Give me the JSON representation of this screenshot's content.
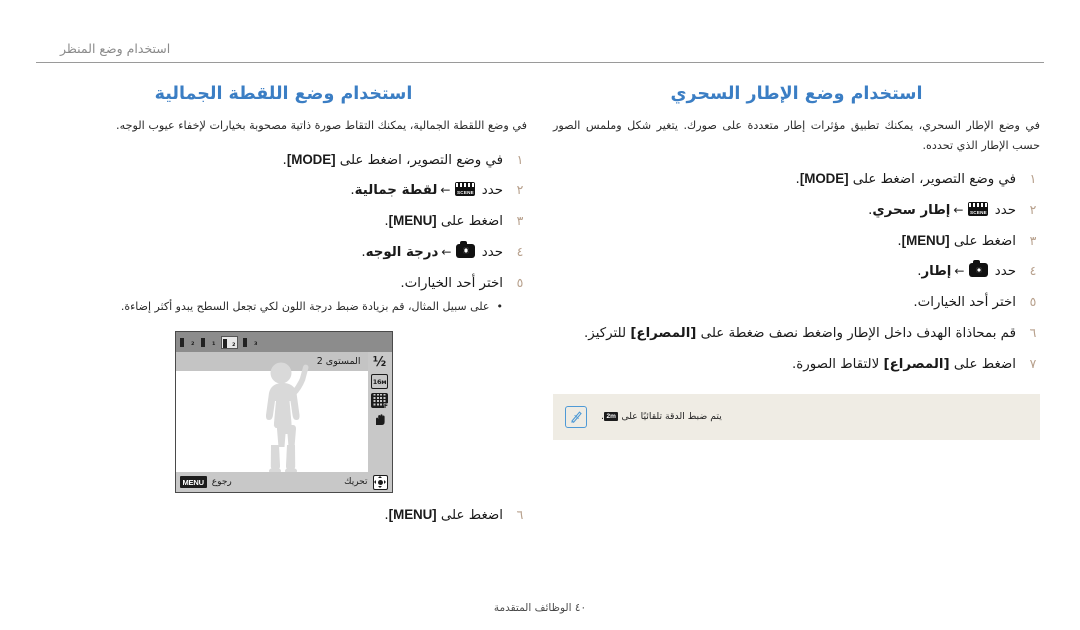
{
  "header": {
    "running_title": "استخدام وضع المنظر"
  },
  "footer": {
    "label": "الوظائف المتقدمة",
    "page_number": "٤٠"
  },
  "right_column": {
    "title": "استخدام وضع الإطار السحري",
    "intro": "في وضع الإطار السحري، يمكنك تطبيق مؤثرات إطار متعددة على صورك. يتغير شكل وملمس الصور حسب الإطار الذي تحدده.",
    "steps": [
      {
        "num": "١",
        "pre": "في وضع التصوير، اضغط على ",
        "kbd": "[MODE]",
        "post": "."
      },
      {
        "num": "٢",
        "pre": "حدد ",
        "icon": "scene-icon",
        "arrow": "←",
        "bold": "إطار سحري",
        "post": "."
      },
      {
        "num": "٣",
        "pre": "اضغط على ",
        "kbd": "[MENU]",
        "post": "."
      },
      {
        "num": "٤",
        "pre": "حدد ",
        "icon": "camera-icon",
        "arrow": "←",
        "bold": "إطار",
        "post": "."
      },
      {
        "num": "٥",
        "pre": "اختر أحد الخيارات.",
        "post": ""
      },
      {
        "num": "٦",
        "pre": "قم بمحاذاة الهدف داخل الإطار واضغط نصف ضغطة على ",
        "bold": "[المصراع]",
        "post": " للتركيز."
      },
      {
        "num": "٧",
        "pre": "اضغط على ",
        "bold": "[المصراع]",
        "post": " لالتقاط الصورة."
      }
    ],
    "note": {
      "icon": "note-pen-icon",
      "text_before": "يتم ضبط الدقة تلقائيًا على ",
      "chip": "2m",
      "text_after": "."
    }
  },
  "left_column": {
    "title": "استخدام وضع اللقطة الجمالية",
    "intro": "في وضع اللقطة الجمالية، يمكنك التقاط صورة ذاتية مصحوبة بخيارات لإخفاء عيوب الوجه.",
    "steps": [
      {
        "num": "١",
        "pre": "في وضع التصوير، اضغط على ",
        "kbd": "[MODE]",
        "post": "."
      },
      {
        "num": "٢",
        "pre": "حدد ",
        "icon": "scene-icon",
        "arrow": "←",
        "bold": "لقطة جمالية",
        "post": "."
      },
      {
        "num": "٣",
        "pre": "اضغط على ",
        "kbd": "[MENU]",
        "post": "."
      },
      {
        "num": "٤",
        "pre": "حدد ",
        "icon": "camera-icon",
        "arrow": "←",
        "bold": "درجة الوجه",
        "post": "."
      },
      {
        "num": "٥",
        "pre": "اختر أحد الخيارات.",
        "post": ""
      }
    ],
    "bullet": "على سبيل المثال، قم بزيادة ضبط درجة اللون لكي تجعل السطح يبدو أكثر إضاءة.",
    "final_step": {
      "num": "٦",
      "pre": "اضغط على ",
      "kbd": "[MENU]",
      "post": "."
    }
  },
  "lcd_screen": {
    "tabs": [
      {
        "name": "tab-1",
        "selected": false
      },
      {
        "name": "tab-2",
        "selected": false
      },
      {
        "name": "tab-3",
        "selected": true
      },
      {
        "name": "tab-4",
        "selected": false
      }
    ],
    "option_label": "المستوى 2",
    "sidebar_icons": [
      "exposure-compensation-icon",
      "resolution-16m-icon",
      "quality-fine-icon",
      "ois-icon"
    ],
    "sidebar_labels": {
      "exposure": "½",
      "resolution": "16м",
      "quality": "F",
      "ois": "OIS"
    },
    "bottom_left_label": "تحريك",
    "bottom_right_label": "رجوع",
    "menu_chip": "MENU",
    "dpad_icon": "dpad-icon"
  },
  "colors": {
    "title_blue": "#3b7ec4",
    "step_number": "#b7a08c",
    "note_bg": "#efece4",
    "note_border": "#4f9ad6",
    "lcd_topbar": "#8c8c8c",
    "lcd_sidebar": "#c8c8c8"
  }
}
